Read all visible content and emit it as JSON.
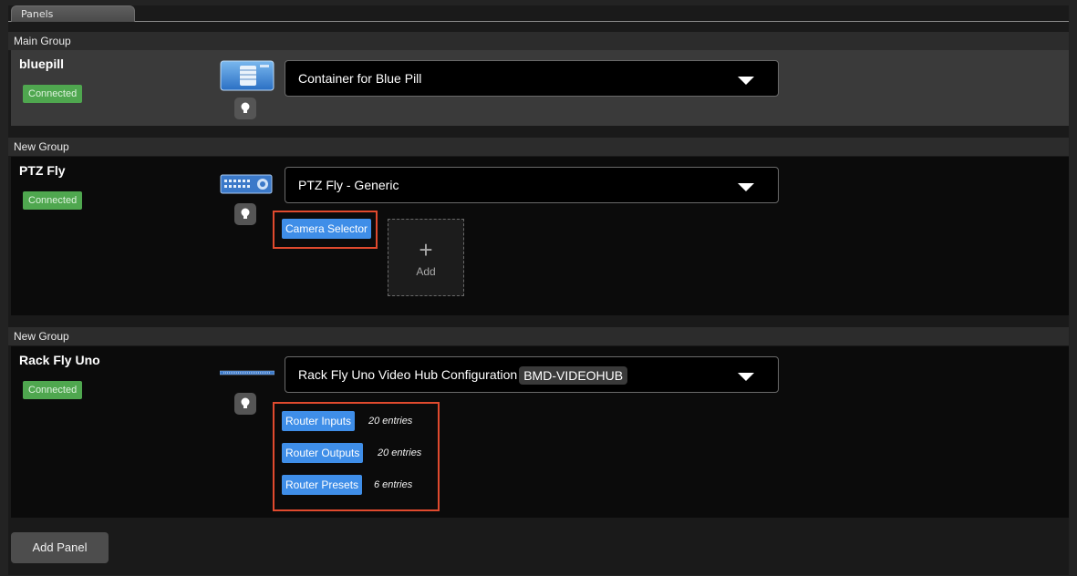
{
  "tabs": {
    "panels": "Panels"
  },
  "groups": [
    {
      "name": "Main Group",
      "panel": {
        "name": "bluepill",
        "status": "Connected",
        "config": "Container for Blue Pill",
        "icon": "container-device-icon"
      }
    },
    {
      "name": "New Group",
      "panel": {
        "name": "PTZ Fly",
        "status": "Connected",
        "config": "PTZ Fly - Generic",
        "icon": "ptz-device-icon",
        "buttons": [
          "Camera Selector"
        ],
        "add_label": "Add"
      }
    },
    {
      "name": "New Group",
      "panel": {
        "name": "Rack Fly Uno",
        "status": "Connected",
        "config": "Rack Fly Uno Video Hub Configuration",
        "config_tag": "BMD-VIDEOHUB",
        "icon": "rack-device-icon",
        "routes": [
          {
            "label": "Router Inputs",
            "entries": "20 entries"
          },
          {
            "label": "Router Outputs",
            "entries": "20 entries"
          },
          {
            "label": "Router Presets",
            "entries": "6 entries"
          }
        ]
      }
    }
  ],
  "footer": {
    "add_panel": "Add Panel"
  },
  "colors": {
    "accent_blue": "#3f8ee8",
    "connected_green": "#4fa74f",
    "highlight_red": "#e04a2e"
  }
}
